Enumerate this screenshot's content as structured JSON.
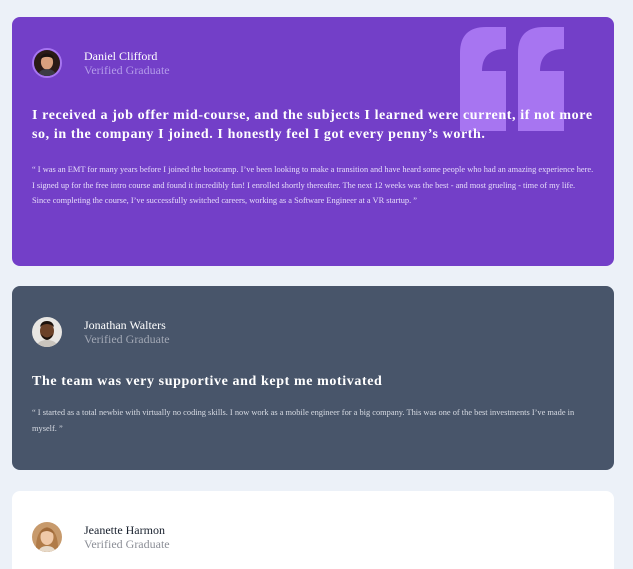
{
  "colors": {
    "page_background": "#ecf1f8",
    "card_violet": "#733fc8",
    "card_slate": "#48556a",
    "card_white": "#ffffff",
    "quote_mark": "#a775f1"
  },
  "testimonials": [
    {
      "name": "Daniel Clifford",
      "role": "Verified Graduate",
      "headline": "I received a job offer mid-course, and the subjects I learned were current, if not more so, in the company I joined. I honestly feel I got every penny’s worth.",
      "body": "“ I was an EMT for many years before I joined the bootcamp. I’ve been looking to make a transition and have heard some people who had an amazing experience here. I signed up for the free intro course and found it incredibly fun! I enrolled shortly thereafter. The next 12 weeks was the best - and most grueling - time of my life. Since completing the course, I’ve successfully switched careers, working as a Software Engineer at a VR startup. ”"
    },
    {
      "name": "Jonathan Walters",
      "role": "Verified Graduate",
      "headline": "The team was very supportive and kept me motivated",
      "body": "“ I started as a total newbie with virtually no coding skills. I now work as a mobile engineer for a big company. This was one of the best investments I’ve made in myself. ”"
    },
    {
      "name": "Jeanette Harmon",
      "role": "Verified Graduate"
    }
  ]
}
